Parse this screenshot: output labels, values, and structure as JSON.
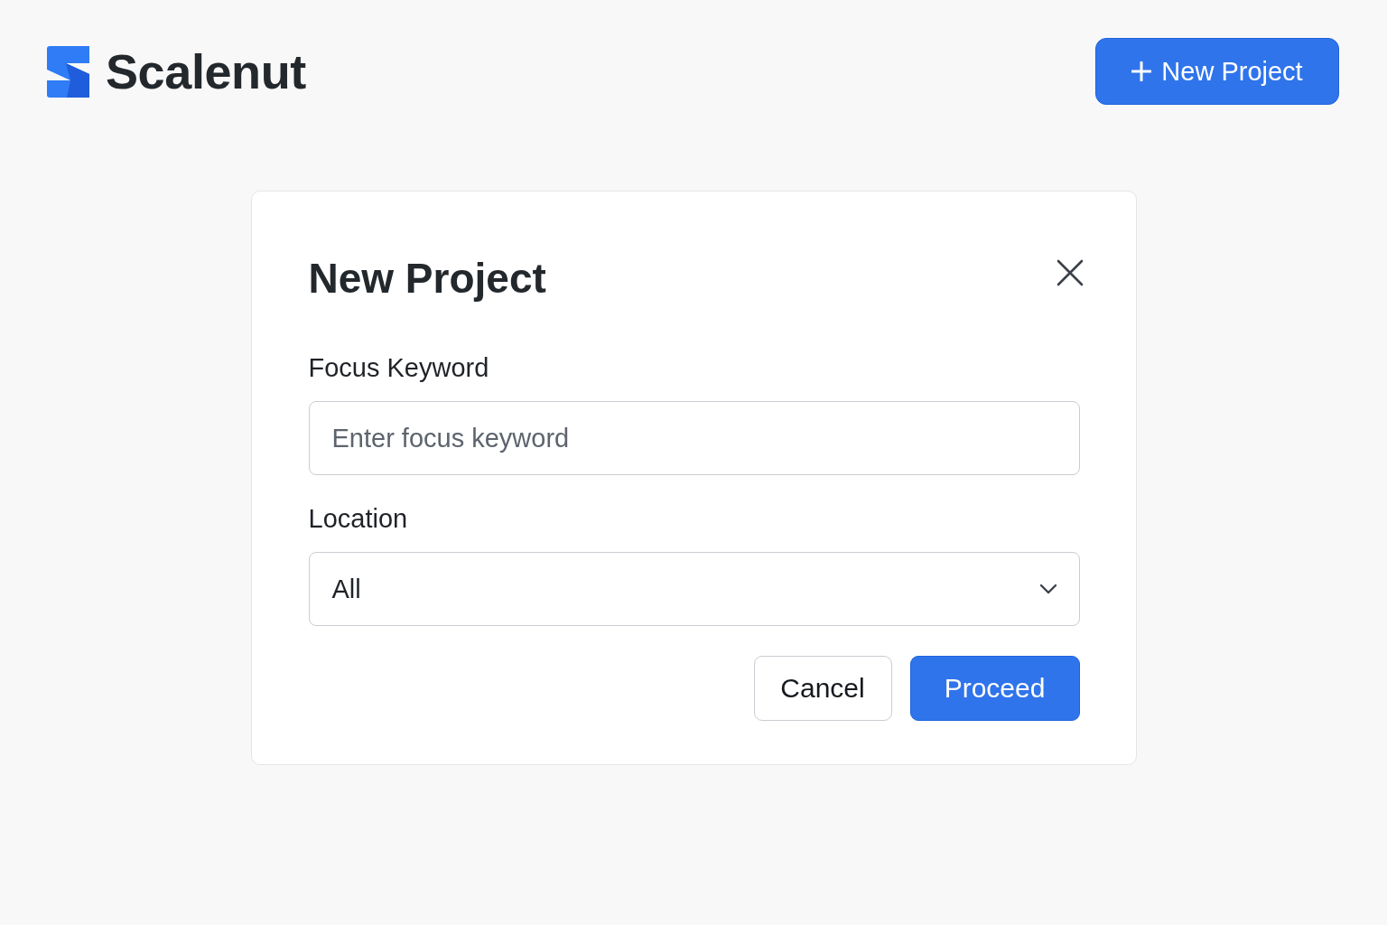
{
  "header": {
    "logo": {
      "text": "Scalenut"
    },
    "new_project_button": {
      "label": "New Project"
    }
  },
  "dialog": {
    "title": "New Project",
    "fields": [
      {
        "kind": "text",
        "label": "Focus Keyword",
        "placeholder": "Enter focus keyword"
      },
      {
        "kind": "select",
        "label": "Location",
        "value": "All"
      }
    ],
    "buttons": [
      {
        "kind": "secondary",
        "label": "Cancel"
      },
      {
        "kind": "primary",
        "label": "Proceed"
      }
    ]
  }
}
